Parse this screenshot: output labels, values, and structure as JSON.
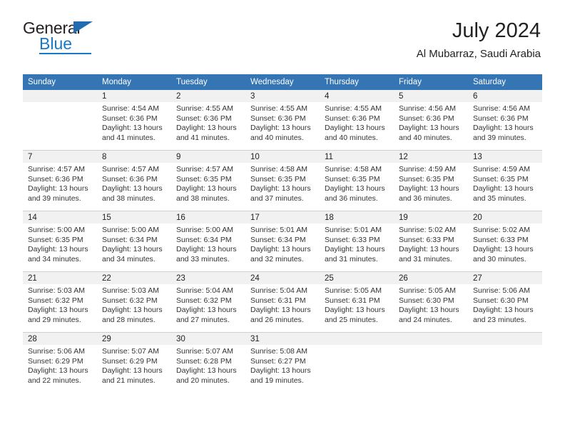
{
  "brand": {
    "name_top": "General",
    "name_bottom": "Blue",
    "accent_color": "#1878c8",
    "triangle_color": "#1f6cb0"
  },
  "header": {
    "title": "July 2024",
    "subtitle": "Al Mubarraz, Saudi Arabia"
  },
  "theme": {
    "header_row_bg": "#3575b4",
    "header_row_text": "#ffffff",
    "daynum_band_bg": "#f1f1f1",
    "cell_bg": "#ffffff",
    "grid_line": "#cfcfcf"
  },
  "weekday_headers": [
    "Sunday",
    "Monday",
    "Tuesday",
    "Wednesday",
    "Thursday",
    "Friday",
    "Saturday"
  ],
  "weeks": [
    [
      {
        "day": "",
        "sunrise": "",
        "sunset": "",
        "daylight_line1": "",
        "daylight_line2": ""
      },
      {
        "day": "1",
        "sunrise": "Sunrise: 4:54 AM",
        "sunset": "Sunset: 6:36 PM",
        "daylight_line1": "Daylight: 13 hours",
        "daylight_line2": "and 41 minutes."
      },
      {
        "day": "2",
        "sunrise": "Sunrise: 4:55 AM",
        "sunset": "Sunset: 6:36 PM",
        "daylight_line1": "Daylight: 13 hours",
        "daylight_line2": "and 41 minutes."
      },
      {
        "day": "3",
        "sunrise": "Sunrise: 4:55 AM",
        "sunset": "Sunset: 6:36 PM",
        "daylight_line1": "Daylight: 13 hours",
        "daylight_line2": "and 40 minutes."
      },
      {
        "day": "4",
        "sunrise": "Sunrise: 4:55 AM",
        "sunset": "Sunset: 6:36 PM",
        "daylight_line1": "Daylight: 13 hours",
        "daylight_line2": "and 40 minutes."
      },
      {
        "day": "5",
        "sunrise": "Sunrise: 4:56 AM",
        "sunset": "Sunset: 6:36 PM",
        "daylight_line1": "Daylight: 13 hours",
        "daylight_line2": "and 40 minutes."
      },
      {
        "day": "6",
        "sunrise": "Sunrise: 4:56 AM",
        "sunset": "Sunset: 6:36 PM",
        "daylight_line1": "Daylight: 13 hours",
        "daylight_line2": "and 39 minutes."
      }
    ],
    [
      {
        "day": "7",
        "sunrise": "Sunrise: 4:57 AM",
        "sunset": "Sunset: 6:36 PM",
        "daylight_line1": "Daylight: 13 hours",
        "daylight_line2": "and 39 minutes."
      },
      {
        "day": "8",
        "sunrise": "Sunrise: 4:57 AM",
        "sunset": "Sunset: 6:36 PM",
        "daylight_line1": "Daylight: 13 hours",
        "daylight_line2": "and 38 minutes."
      },
      {
        "day": "9",
        "sunrise": "Sunrise: 4:57 AM",
        "sunset": "Sunset: 6:35 PM",
        "daylight_line1": "Daylight: 13 hours",
        "daylight_line2": "and 38 minutes."
      },
      {
        "day": "10",
        "sunrise": "Sunrise: 4:58 AM",
        "sunset": "Sunset: 6:35 PM",
        "daylight_line1": "Daylight: 13 hours",
        "daylight_line2": "and 37 minutes."
      },
      {
        "day": "11",
        "sunrise": "Sunrise: 4:58 AM",
        "sunset": "Sunset: 6:35 PM",
        "daylight_line1": "Daylight: 13 hours",
        "daylight_line2": "and 36 minutes."
      },
      {
        "day": "12",
        "sunrise": "Sunrise: 4:59 AM",
        "sunset": "Sunset: 6:35 PM",
        "daylight_line1": "Daylight: 13 hours",
        "daylight_line2": "and 36 minutes."
      },
      {
        "day": "13",
        "sunrise": "Sunrise: 4:59 AM",
        "sunset": "Sunset: 6:35 PM",
        "daylight_line1": "Daylight: 13 hours",
        "daylight_line2": "and 35 minutes."
      }
    ],
    [
      {
        "day": "14",
        "sunrise": "Sunrise: 5:00 AM",
        "sunset": "Sunset: 6:35 PM",
        "daylight_line1": "Daylight: 13 hours",
        "daylight_line2": "and 34 minutes."
      },
      {
        "day": "15",
        "sunrise": "Sunrise: 5:00 AM",
        "sunset": "Sunset: 6:34 PM",
        "daylight_line1": "Daylight: 13 hours",
        "daylight_line2": "and 34 minutes."
      },
      {
        "day": "16",
        "sunrise": "Sunrise: 5:00 AM",
        "sunset": "Sunset: 6:34 PM",
        "daylight_line1": "Daylight: 13 hours",
        "daylight_line2": "and 33 minutes."
      },
      {
        "day": "17",
        "sunrise": "Sunrise: 5:01 AM",
        "sunset": "Sunset: 6:34 PM",
        "daylight_line1": "Daylight: 13 hours",
        "daylight_line2": "and 32 minutes."
      },
      {
        "day": "18",
        "sunrise": "Sunrise: 5:01 AM",
        "sunset": "Sunset: 6:33 PM",
        "daylight_line1": "Daylight: 13 hours",
        "daylight_line2": "and 31 minutes."
      },
      {
        "day": "19",
        "sunrise": "Sunrise: 5:02 AM",
        "sunset": "Sunset: 6:33 PM",
        "daylight_line1": "Daylight: 13 hours",
        "daylight_line2": "and 31 minutes."
      },
      {
        "day": "20",
        "sunrise": "Sunrise: 5:02 AM",
        "sunset": "Sunset: 6:33 PM",
        "daylight_line1": "Daylight: 13 hours",
        "daylight_line2": "and 30 minutes."
      }
    ],
    [
      {
        "day": "21",
        "sunrise": "Sunrise: 5:03 AM",
        "sunset": "Sunset: 6:32 PM",
        "daylight_line1": "Daylight: 13 hours",
        "daylight_line2": "and 29 minutes."
      },
      {
        "day": "22",
        "sunrise": "Sunrise: 5:03 AM",
        "sunset": "Sunset: 6:32 PM",
        "daylight_line1": "Daylight: 13 hours",
        "daylight_line2": "and 28 minutes."
      },
      {
        "day": "23",
        "sunrise": "Sunrise: 5:04 AM",
        "sunset": "Sunset: 6:32 PM",
        "daylight_line1": "Daylight: 13 hours",
        "daylight_line2": "and 27 minutes."
      },
      {
        "day": "24",
        "sunrise": "Sunrise: 5:04 AM",
        "sunset": "Sunset: 6:31 PM",
        "daylight_line1": "Daylight: 13 hours",
        "daylight_line2": "and 26 minutes."
      },
      {
        "day": "25",
        "sunrise": "Sunrise: 5:05 AM",
        "sunset": "Sunset: 6:31 PM",
        "daylight_line1": "Daylight: 13 hours",
        "daylight_line2": "and 25 minutes."
      },
      {
        "day": "26",
        "sunrise": "Sunrise: 5:05 AM",
        "sunset": "Sunset: 6:30 PM",
        "daylight_line1": "Daylight: 13 hours",
        "daylight_line2": "and 24 minutes."
      },
      {
        "day": "27",
        "sunrise": "Sunrise: 5:06 AM",
        "sunset": "Sunset: 6:30 PM",
        "daylight_line1": "Daylight: 13 hours",
        "daylight_line2": "and 23 minutes."
      }
    ],
    [
      {
        "day": "28",
        "sunrise": "Sunrise: 5:06 AM",
        "sunset": "Sunset: 6:29 PM",
        "daylight_line1": "Daylight: 13 hours",
        "daylight_line2": "and 22 minutes."
      },
      {
        "day": "29",
        "sunrise": "Sunrise: 5:07 AM",
        "sunset": "Sunset: 6:29 PM",
        "daylight_line1": "Daylight: 13 hours",
        "daylight_line2": "and 21 minutes."
      },
      {
        "day": "30",
        "sunrise": "Sunrise: 5:07 AM",
        "sunset": "Sunset: 6:28 PM",
        "daylight_line1": "Daylight: 13 hours",
        "daylight_line2": "and 20 minutes."
      },
      {
        "day": "31",
        "sunrise": "Sunrise: 5:08 AM",
        "sunset": "Sunset: 6:27 PM",
        "daylight_line1": "Daylight: 13 hours",
        "daylight_line2": "and 19 minutes."
      },
      {
        "day": "",
        "sunrise": "",
        "sunset": "",
        "daylight_line1": "",
        "daylight_line2": ""
      },
      {
        "day": "",
        "sunrise": "",
        "sunset": "",
        "daylight_line1": "",
        "daylight_line2": ""
      },
      {
        "day": "",
        "sunrise": "",
        "sunset": "",
        "daylight_line1": "",
        "daylight_line2": ""
      }
    ]
  ]
}
